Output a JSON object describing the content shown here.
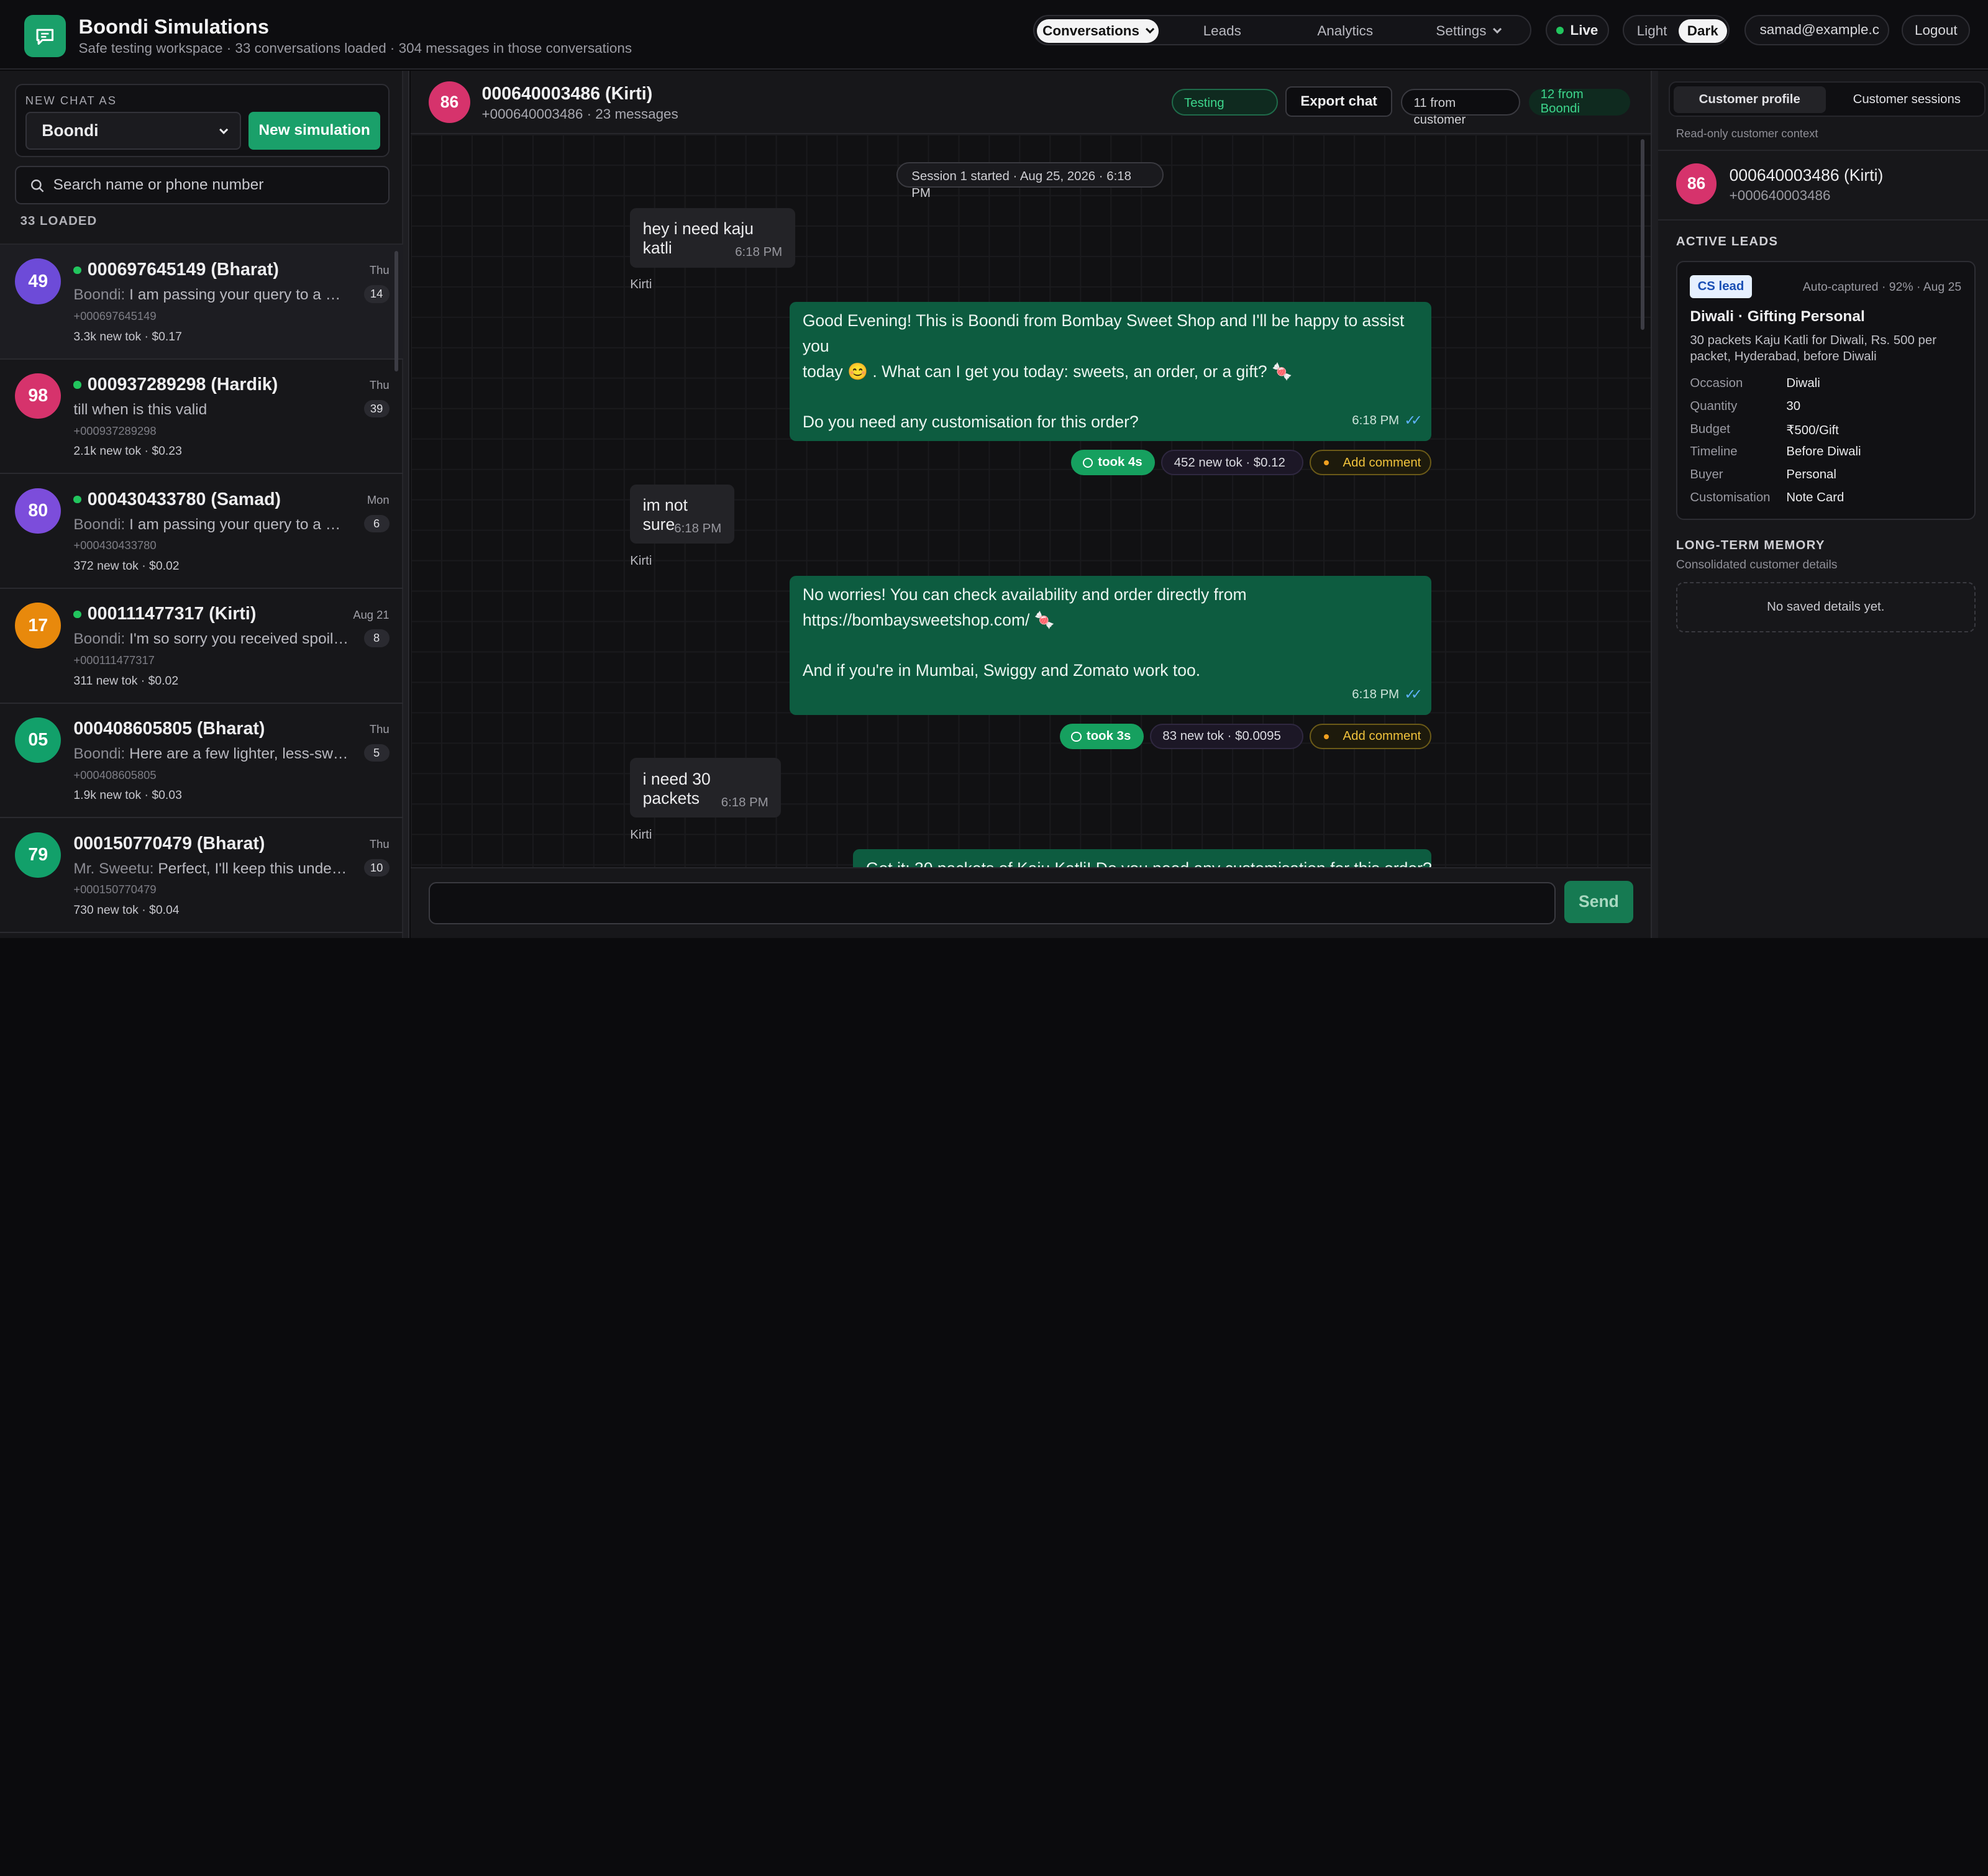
{
  "app": {
    "title": "Boondi Simulations",
    "subtitle": "Safe testing workspace · 33 conversations loaded · 304 messages in those conversations"
  },
  "nav": {
    "conversations": "Conversations",
    "leads": "Leads",
    "analytics": "Analytics",
    "settings": "Settings"
  },
  "status": {
    "live": "Live"
  },
  "theme": {
    "light": "Light",
    "dark": "Dark",
    "selected": "Dark"
  },
  "user": {
    "email": "samad@example.c",
    "logout": "Logout"
  },
  "sidebar": {
    "new_chat_label": "NEW CHAT AS",
    "new_chat_as": "Boondi",
    "new_simulation": "New simulation",
    "search_placeholder": "Search name or phone number",
    "loaded": "33 LOADED",
    "conversations": [
      {
        "initials": "49",
        "avatar_color": "#6d4bd8",
        "name": "000697645149 (Bharat)",
        "online": true,
        "time": "Thu",
        "sender": "Boondi:",
        "preview": " I am passing your query to a Mi…",
        "count": "14",
        "phone": "+000697645149",
        "tokens": "3.3k new tok · $0.17"
      },
      {
        "initials": "98",
        "avatar_color": "#d6336c",
        "name": "000937289298 (Hardik)",
        "online": true,
        "time": "Thu",
        "sender": "",
        "preview": "till when is this valid",
        "count": "39",
        "phone": "+000937289298",
        "tokens": "2.1k new tok · $0.23"
      },
      {
        "initials": "80",
        "avatar_color": "#7c4ddb",
        "name": "000430433780 (Samad)",
        "online": true,
        "time": "Mon",
        "sender": "Boondi:",
        "preview": " I am passing your query to a Mit…",
        "count": "6",
        "phone": "+000430433780",
        "tokens": "372 new tok · $0.02"
      },
      {
        "initials": "17",
        "avatar_color": "#e8890c",
        "name": "000111477317 (Kirti)",
        "online": true,
        "time": "Aug 21",
        "sender": "Boondi:",
        "preview": " I'm so sorry you received spoile…",
        "count": "8",
        "phone": "+000111477317",
        "tokens": "311 new tok · $0.02"
      },
      {
        "initials": "05",
        "avatar_color": "#12a06a",
        "name": "000408605805 (Bharat)",
        "online": false,
        "time": "Thu",
        "sender": "Boondi:",
        "preview": " Here are a few lighter, less-swe…",
        "count": "5",
        "phone": "+000408605805",
        "tokens": "1.9k new tok · $0.03"
      },
      {
        "initials": "79",
        "avatar_color": "#12a06a",
        "name": "000150770479 (Bharat)",
        "online": false,
        "time": "Thu",
        "sender": "Mr. Sweetu:",
        "preview": " Perfect, I'll keep this under…",
        "count": "10",
        "phone": "+000150770479",
        "tokens": "730 new tok · $0.04"
      }
    ]
  },
  "chat": {
    "avatar": "86",
    "avatar_color": "#d6336c",
    "name": "000640003486 (Kirti)",
    "sub": "+000640003486 · 23 messages",
    "testing": "Testing Boondi",
    "export": "Export chat",
    "from_customer": "11 from customer",
    "from_boondi": "12 from Boondi",
    "session": "Session 1 started · Aug 25, 2026 · 6:18 PM",
    "messages": {
      "m1": {
        "text": "hey i need kaju katli",
        "time": "6:18 PM",
        "sender": "Kirti"
      },
      "m2": {
        "line1": "Good Evening! This is Boondi from Bombay Sweet Shop and I'll be happy to assist you",
        "line2": "today 😊 . What can I get you today: sweets, an order, or a gift? 🍬",
        "line3": "Do you need any customisation for this order?",
        "time": "6:18 PM",
        "took": "took 4s",
        "tokens": "452 new tok · $0.12",
        "comment": "Add comment"
      },
      "m3": {
        "text": "im not sure",
        "time": "6:18 PM",
        "sender": "Kirti"
      },
      "m4": {
        "line1": "No worries! You can check availability and order directly from",
        "line2": "https://bombaysweetshop.com/ 🍬",
        "line3": "And if you're in Mumbai, Swiggy and Zomato work too.",
        "time": "6:18 PM",
        "took": "took 3s",
        "tokens": "83 new tok · $0.0095",
        "comment": "Add comment"
      },
      "m5": {
        "text": "i need 30 packets",
        "time": "6:18 PM",
        "sender": "Kirti"
      },
      "m6": {
        "text": "Got it: 30 packets of Kaju Katli! Do you need any customisation for this order?"
      }
    },
    "send": "Send"
  },
  "profile": {
    "tab_profile": "Customer profile",
    "tab_sessions": "Customer sessions",
    "readonly": "Read-only customer context",
    "avatar": "86",
    "name": "000640003486 (Kirti)",
    "phone": "+000640003486",
    "active_leads": "ACTIVE LEADS",
    "lead": {
      "badge": "CS lead",
      "auto": "Auto-captured · 92% · Aug 25",
      "title": "Diwali · Gifting Personal",
      "desc": "30 packets Kaju Katli for Diwali, Rs. 500 per packet, Hyderabad, before Diwali",
      "fields": [
        {
          "k": "Occasion",
          "v": "Diwali"
        },
        {
          "k": "Quantity",
          "v": "30"
        },
        {
          "k": "Budget",
          "v": "₹500/Gift"
        },
        {
          "k": "Timeline",
          "v": "Before Diwali"
        },
        {
          "k": "Buyer",
          "v": "Personal"
        },
        {
          "k": "Customisation",
          "v": "Note Card"
        }
      ]
    },
    "memory_title": "LONG-TERM MEMORY",
    "memory_sub": "Consolidated customer details",
    "memory_empty": "No saved details yet."
  },
  "colors": {
    "accent": "#1aa06a",
    "bubble_out": "#0d5c40",
    "bubble_in": "#232327"
  }
}
